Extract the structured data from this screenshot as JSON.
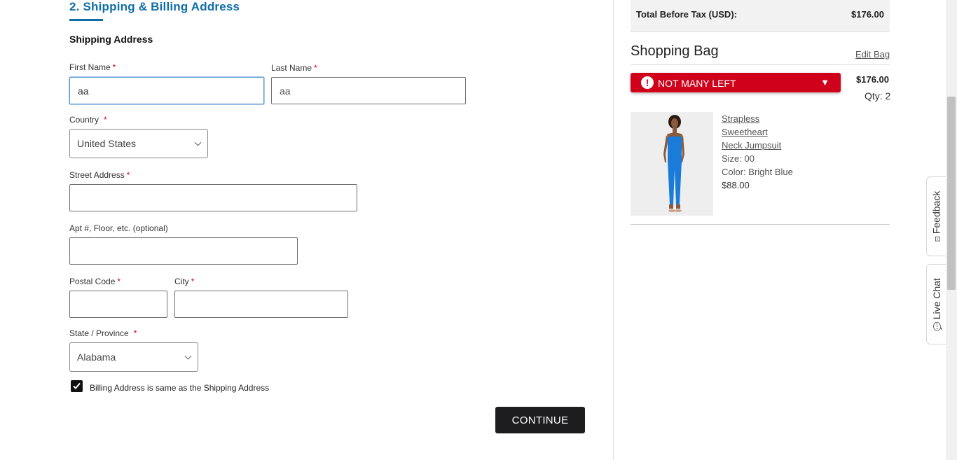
{
  "form": {
    "section_title": "2. Shipping & Billing Address",
    "sub_title": "Shipping Address",
    "first_name": {
      "label": "First Name",
      "value": "aa"
    },
    "last_name": {
      "label": "Last Name",
      "value": "aa"
    },
    "country": {
      "label": "Country",
      "value": "United States"
    },
    "street": {
      "label": "Street Address",
      "value": ""
    },
    "apt": {
      "label": "Apt #, Floor, etc. (optional)",
      "value": ""
    },
    "postal": {
      "label": "Postal Code",
      "value": ""
    },
    "city": {
      "label": "City",
      "value": ""
    },
    "state": {
      "label": "State / Province",
      "value": "Alabama"
    },
    "billing_same": {
      "label": "Billing Address is same as the Shipping Address",
      "checked": true
    },
    "required_mark": "*",
    "continue_label": "CONTINUE"
  },
  "summary": {
    "total_label": "Total Before Tax (USD):",
    "total_value": "$176.00",
    "bag_title": "Shopping Bag",
    "edit_bag": "Edit Bag",
    "alert_text": "NOT MANY LEFT",
    "alert_icon": "!",
    "alert_caret": "▼",
    "bag_price": "$176.00",
    "bag_qty": "Qty: 2",
    "item": {
      "name_line1": "Strapless",
      "name_line2": "Sweetheart",
      "name_line3": "Neck Jumpsuit",
      "size": "Size: 00",
      "color": "Color: Bright Blue",
      "price": "$88.00"
    }
  },
  "side_tabs": {
    "feedback": "Feedback",
    "live_chat": "Live Chat"
  },
  "colors": {
    "accent": "#0f6ea8",
    "alert": "#d0021b",
    "button": "#1d1d1f",
    "product_blue": "#1a7bd8"
  }
}
